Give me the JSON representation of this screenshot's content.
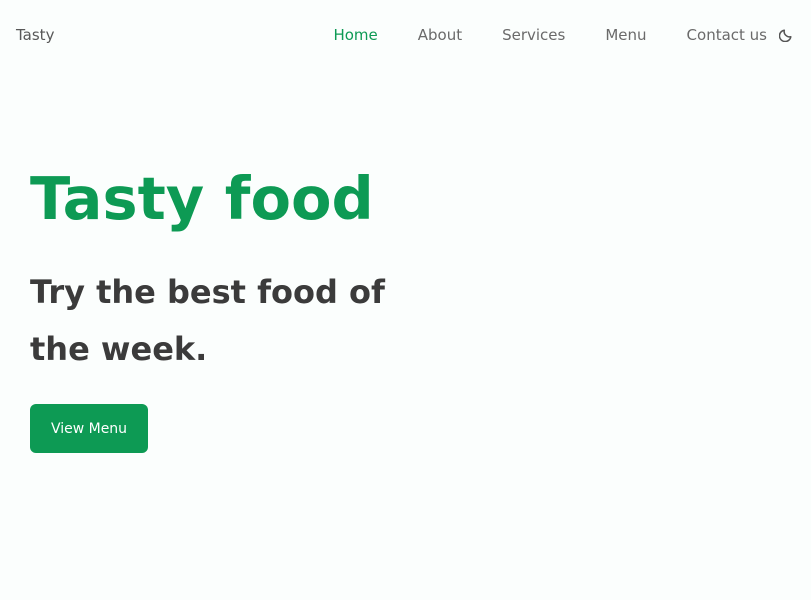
{
  "header": {
    "logo": "Tasty",
    "nav": [
      {
        "label": "Home",
        "active": true
      },
      {
        "label": "About",
        "active": false
      },
      {
        "label": "Services",
        "active": false
      },
      {
        "label": "Menu",
        "active": false
      },
      {
        "label": "Contact us",
        "active": false
      }
    ],
    "theme_toggle_icon": "moon-icon"
  },
  "hero": {
    "title": "Tasty food",
    "subtitle": "Try the best food of the week.",
    "button_label": "View Menu"
  },
  "colors": {
    "accent": "#0d9a54",
    "background": "#fbfefd",
    "heading_text": "#3b3b3b",
    "nav_text": "#6a6a6a"
  }
}
